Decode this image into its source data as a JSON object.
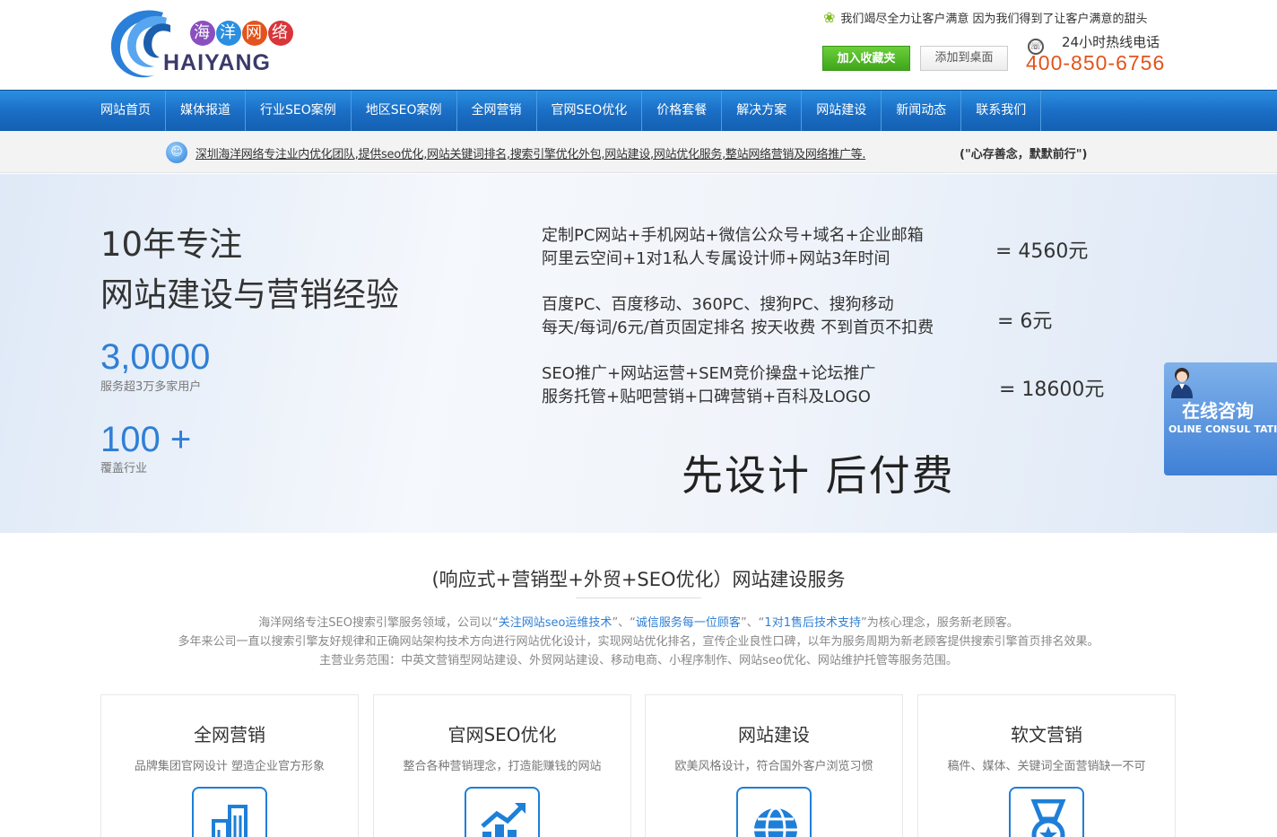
{
  "logo": {
    "cn": [
      "海",
      "洋",
      "网",
      "络"
    ],
    "en": "HAIYANG"
  },
  "header": {
    "slogan": "我们竭尽全力让客户满意 因为我们得到了让客户满意的甜头",
    "fav_button": "加入收藏夹",
    "desktop_button": "添加到桌面",
    "hotline_label": "24小时热线电话",
    "hotline_number": "400-850-6756"
  },
  "nav": {
    "items": [
      "网站首页",
      "媒体报道",
      "行业SEO案例",
      "地区SEO案例",
      "全网营销",
      "官网SEO优化",
      "价格套餐",
      "解决方案",
      "网站建设",
      "新闻动态",
      "联系我们"
    ]
  },
  "notice": {
    "text": "深圳海洋网络专注业内优化团队,提供seo优化,网站关键词排名,搜索引擎优化外包,网站建设,网站优化服务,整站网络营销及网络推广等.",
    "motto": "(\"心存善念，默默前行\")"
  },
  "hero": {
    "title1": "10年专注",
    "title2": "网站建设与营销经验",
    "stat1_value": "3,0000",
    "stat1_label": "服务超3万多家用户",
    "stat2_value": "100 +",
    "stat2_label": "覆盖行业",
    "packages": [
      {
        "line1": "定制PC网站+手机网站+微信公众号+域名+企业邮箱",
        "line2": "阿里云空间+1对1私人专属设计师+网站3年时间",
        "price": "=  4560元"
      },
      {
        "line1": "百度PC、百度移动、360PC、搜狗PC、搜狗移动",
        "line2": "每天/每词/6元/首页固定排名 按天收费 不到首页不扣费",
        "price": "=  6元"
      },
      {
        "line1": "SEO推广+网站运营+SEM竞价操盘+论坛推广",
        "line2": "服务托管+贴吧营销+口碑营销+百科及LOGO",
        "price": "=  18600元"
      }
    ],
    "tagline": "先设计 后付费"
  },
  "consult": {
    "title": "在线咨询",
    "subtitle": "OLINE CONSUL TATION"
  },
  "services": {
    "title": "(响应式+营销型+外贸+SEO优化）网站建设服务",
    "desc1_pre": "海洋网络专注SEO搜索引擎服务领域，公司以“",
    "desc1_hl1": "关注网站seo运维技术",
    "desc1_mid1": "”、“",
    "desc1_hl2": "诚信服务每一位顾客",
    "desc1_mid2": "”、“",
    "desc1_hl3": "1对1售后技术支持",
    "desc1_post": "”为核心理念，服务新老顾客。",
    "desc2": "多年来公司一直以搜索引擎友好规律和正确网站架构技术方向进行网站优化设计，实现网站优化排名，宣传企业良性口碑，以年为服务周期为新老顾客提供搜索引擎首页排名效果。",
    "desc3": "主营业务范围：中英文营销型网站建设、外贸网站建设、移动电商、小程序制作、网站seo优化、网站维护托管等服务范围。",
    "cards": [
      {
        "title": "全网营销",
        "sub": "品牌集团官网设计 塑造企业官方形象",
        "icon": "buildings-icon"
      },
      {
        "title": "官网SEO优化",
        "sub": "整合各种营销理念，打造能赚钱的网站",
        "icon": "chart-growth-icon"
      },
      {
        "title": "网站建设",
        "sub": "欧美风格设计，符合国外客户浏览习惯",
        "icon": "globe-icon"
      },
      {
        "title": "软文营销",
        "sub": "稿件、媒体、关键词全面营销缺一不可",
        "icon": "medal-icon"
      }
    ]
  },
  "colors": {
    "nav_blue": "#1b6fc6",
    "accent_blue": "#2f7fd6",
    "hotline_orange": "#e2541c",
    "fav_green": "#4fb52a"
  }
}
